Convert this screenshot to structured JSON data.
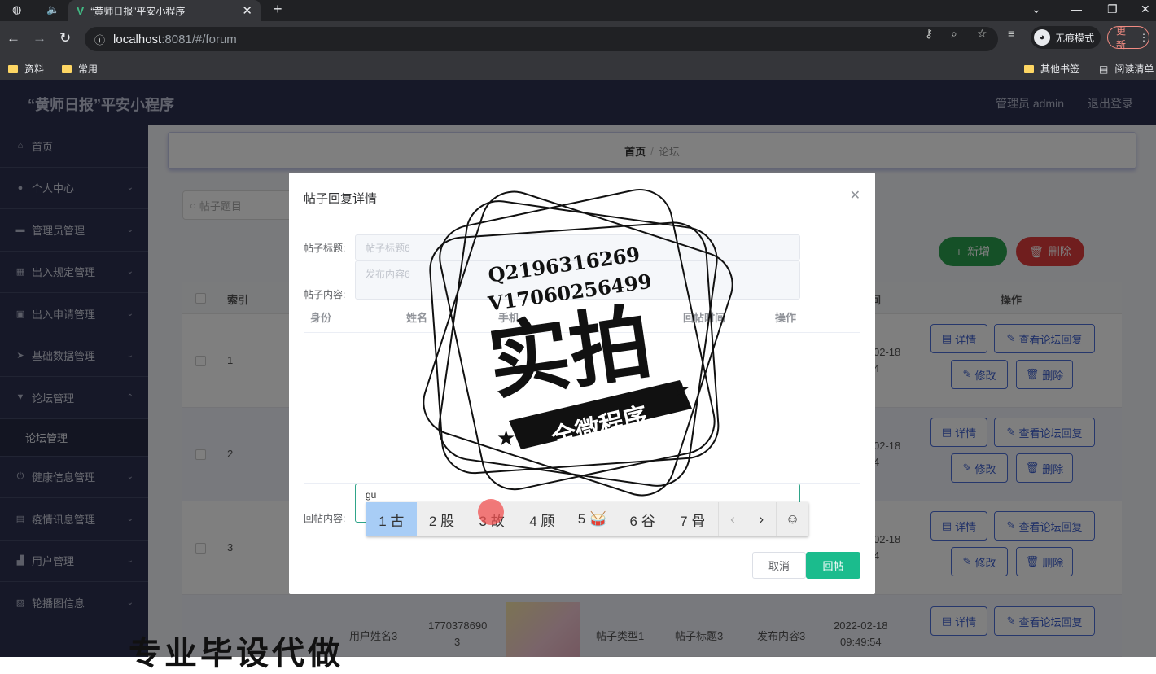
{
  "browser": {
    "tab_title": "“黄师日报”平安小程序",
    "url_host": "localhost",
    "url_path": ":8081/#/forum",
    "incognito_label": "无痕模式",
    "update_label": "更新",
    "bookmarks": [
      "资料",
      "常用"
    ],
    "bookmarks_right": [
      "其他书签",
      "阅读清单"
    ]
  },
  "app": {
    "title": "“黄师日报”平安小程序",
    "user": "管理员 admin",
    "logout": "退出登录"
  },
  "sidebar": {
    "items": [
      {
        "label": "首页",
        "icon": "home-icon"
      },
      {
        "label": "个人中心",
        "icon": "user-icon"
      },
      {
        "label": "管理员管理",
        "icon": "monitor-icon"
      },
      {
        "label": "出入规定管理",
        "icon": "grid-icon"
      },
      {
        "label": "出入申请管理",
        "icon": "clipboard-icon"
      },
      {
        "label": "基础数据管理",
        "icon": "send-icon"
      },
      {
        "label": "论坛管理",
        "icon": "forum-icon"
      },
      {
        "label": "健康信息管理",
        "icon": "power-icon"
      },
      {
        "label": "疫情讯息管理",
        "icon": "document-icon"
      },
      {
        "label": "用户管理",
        "icon": "chart-icon"
      },
      {
        "label": "轮播图信息",
        "icon": "image-icon"
      }
    ],
    "sub_item": "论坛管理"
  },
  "breadcrumb": {
    "home": "首页",
    "sep": "/",
    "current": "论坛"
  },
  "search": {
    "placeholder": "帖子题目"
  },
  "actions": {
    "add": "新增",
    "delete": "删除"
  },
  "table": {
    "headers": {
      "index": "索引",
      "time": "间",
      "ops": "操作"
    },
    "rows": [
      {
        "index": "1",
        "time1": "02-18",
        "time2": "4"
      },
      {
        "index": "2",
        "time1": "02-18",
        "time2": "4"
      },
      {
        "index": "3",
        "time1": "02-18",
        "time2": "4"
      }
    ],
    "partial_row": {
      "name": "用户姓名3",
      "phone1": "1770378690",
      "phone2": "3",
      "type": "帖子类型1",
      "title": "帖子标题3",
      "content": "发布内容3",
      "time1": "2022-02-18",
      "time2": "09:49:54"
    },
    "row_buttons": {
      "detail": "详情",
      "view_reply": "查看论坛回复",
      "edit": "修改",
      "delete": "删除"
    }
  },
  "dialog": {
    "title": "帖子回复详情",
    "post_title_label": "帖子标题:",
    "post_title_value": "帖子标题6",
    "post_content_label": "帖子内容:",
    "post_content_value": "发布内容6",
    "reply_columns": [
      "身份",
      "姓名",
      "手机",
      "回帖时间",
      "操作"
    ],
    "reply_label": "回帖内容:",
    "reply_value": "gu",
    "cancel": "取消",
    "submit": "回帖"
  },
  "ime": {
    "candidates": [
      "1 古",
      "2 股",
      "3 故",
      "4 顾",
      "5 🥁",
      "6 谷",
      "7 骨"
    ]
  },
  "watermark": {
    "line1": "Q2196316269",
    "line2": "V17060256499",
    "big": "实拍",
    "banner": "全微程序"
  },
  "overlay_text": "专业毕设代做"
}
